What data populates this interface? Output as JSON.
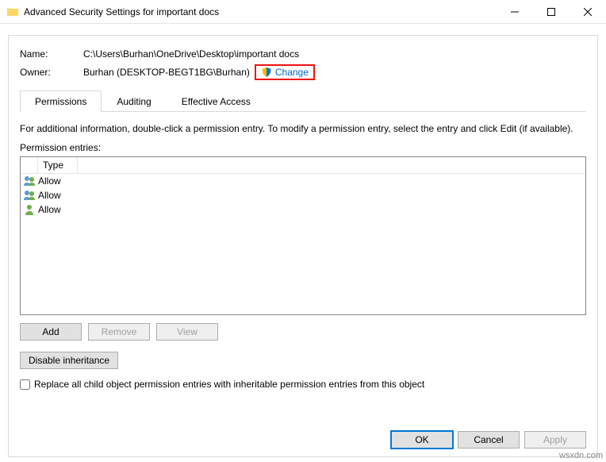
{
  "window": {
    "title": "Advanced Security Settings for important docs"
  },
  "fields": {
    "name_label": "Name:",
    "name_value": "C:\\Users\\Burhan\\OneDrive\\Desktop\\important docs",
    "owner_label": "Owner:",
    "owner_value": "Burhan (DESKTOP-BEGT1BG\\Burhan)",
    "change_link": "Change"
  },
  "tabs": {
    "permissions": "Permissions",
    "auditing": "Auditing",
    "effective": "Effective Access"
  },
  "info": "For additional information, double-click a permission entry. To modify a permission entry, select the entry and click Edit (if available).",
  "entries_label": "Permission entries:",
  "grid": {
    "header_type": "Type",
    "rows": [
      {
        "type": "Allow",
        "icon": "group"
      },
      {
        "type": "Allow",
        "icon": "group"
      },
      {
        "type": "Allow",
        "icon": "user"
      }
    ]
  },
  "buttons": {
    "add": "Add",
    "remove": "Remove",
    "view": "View",
    "disable_inheritance": "Disable inheritance",
    "ok": "OK",
    "cancel": "Cancel",
    "apply": "Apply"
  },
  "replace_checkbox": "Replace all child object permission entries with inheritable permission entries from this object",
  "watermark": "wsxdn.com"
}
